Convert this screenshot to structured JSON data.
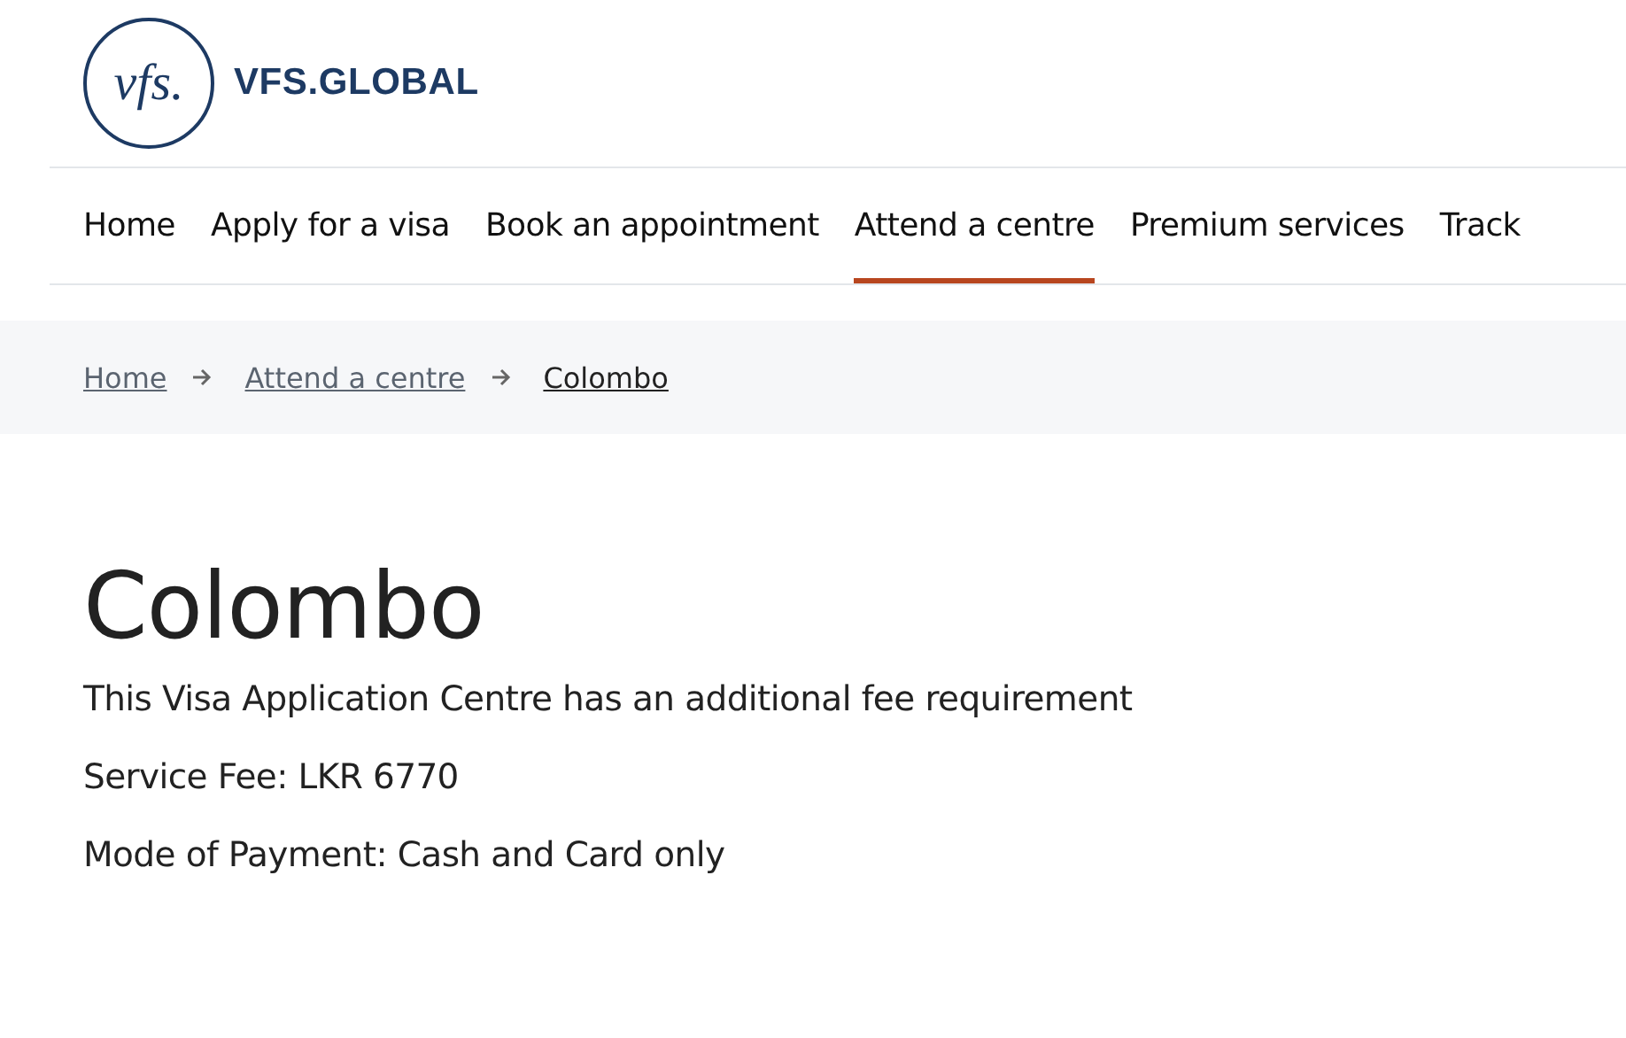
{
  "logo": {
    "monogram": "vfs.",
    "wordmark": "VFS.GLOBAL"
  },
  "nav": [
    {
      "label": "Home",
      "selected": false
    },
    {
      "label": "Apply for a visa",
      "selected": false
    },
    {
      "label": "Book an appointment",
      "selected": false
    },
    {
      "label": "Attend a centre",
      "selected": true
    },
    {
      "label": "Premium services",
      "selected": false
    },
    {
      "label": "Track",
      "selected": false
    }
  ],
  "breadcrumb": [
    {
      "label": "Home",
      "current": false
    },
    {
      "label": "Attend a centre",
      "current": false
    },
    {
      "label": "Colombo",
      "current": true
    }
  ],
  "title": "Colombo",
  "paragraphs": [
    "This Visa Application Centre has an additional fee requirement",
    "Service Fee: LKR 6770",
    "Mode of Payment: Cash and Card only"
  ]
}
